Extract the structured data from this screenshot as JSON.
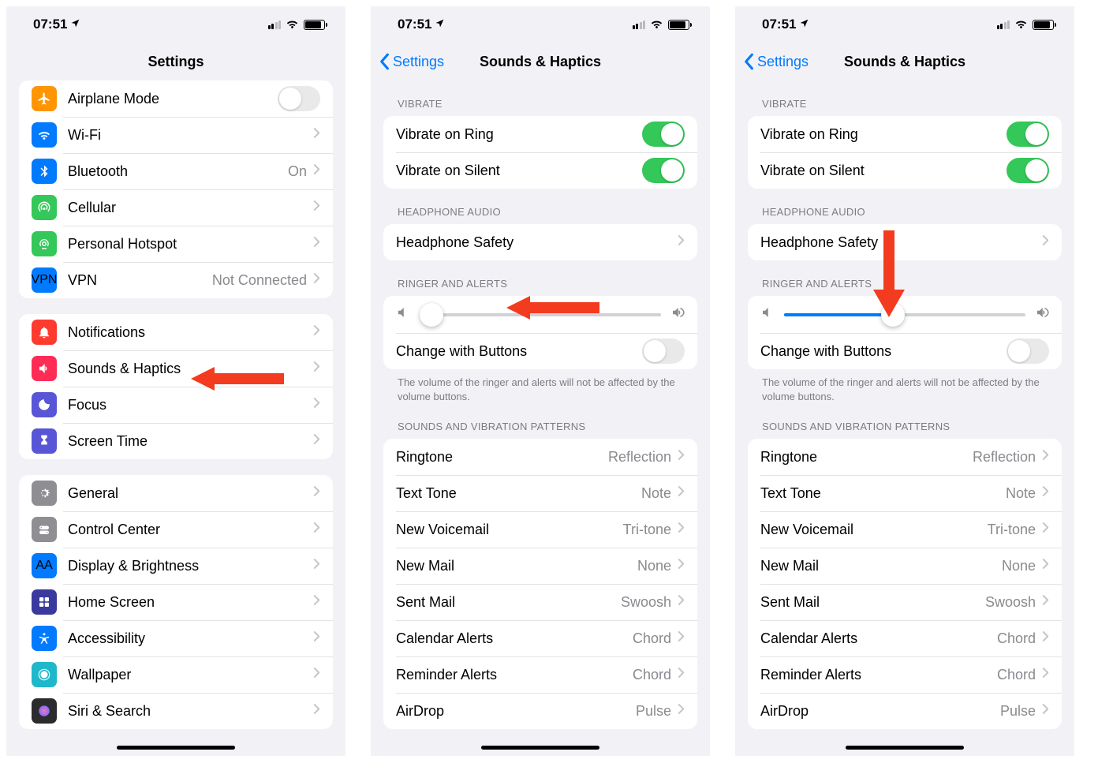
{
  "status": {
    "time": "07:51"
  },
  "screen1": {
    "title": "Settings",
    "group1": [
      {
        "label": "Airplane Mode",
        "icon": "airplane",
        "color": "#ff9500",
        "toggle": false
      },
      {
        "label": "Wi-Fi",
        "icon": "wifi",
        "color": "#007aff",
        "chevron": true
      },
      {
        "label": "Bluetooth",
        "icon": "bluetooth",
        "color": "#007aff",
        "value": "On",
        "chevron": true
      },
      {
        "label": "Cellular",
        "icon": "cellular",
        "color": "#34c759",
        "chevron": true
      },
      {
        "label": "Personal Hotspot",
        "icon": "hotspot",
        "color": "#34c759",
        "chevron": true
      },
      {
        "label": "VPN",
        "icon": "vpn",
        "color": "#007aff",
        "value": "Not Connected",
        "chevron": true
      }
    ],
    "group2": [
      {
        "label": "Notifications",
        "icon": "bell",
        "color": "#ff3b30",
        "chevron": true
      },
      {
        "label": "Sounds & Haptics",
        "icon": "speaker",
        "color": "#ff2d55",
        "chevron": true
      },
      {
        "label": "Focus",
        "icon": "moon",
        "color": "#5856d6",
        "chevron": true
      },
      {
        "label": "Screen Time",
        "icon": "hourglass",
        "color": "#5856d6",
        "chevron": true
      }
    ],
    "group3": [
      {
        "label": "General",
        "icon": "gear",
        "color": "#8e8e93",
        "chevron": true
      },
      {
        "label": "Control Center",
        "icon": "switches",
        "color": "#8e8e93",
        "chevron": true
      },
      {
        "label": "Display & Brightness",
        "icon": "aa",
        "color": "#007aff",
        "chevron": true
      },
      {
        "label": "Home Screen",
        "icon": "grid",
        "color": "#3a3a9e",
        "chevron": true
      },
      {
        "label": "Accessibility",
        "icon": "accessibility",
        "color": "#007aff",
        "chevron": true
      },
      {
        "label": "Wallpaper",
        "icon": "wallpaper",
        "color": "#1fb8ca",
        "chevron": true
      },
      {
        "label": "Siri & Search",
        "icon": "siri",
        "color": "#2c2c2e",
        "chevron": true
      }
    ]
  },
  "screen2": {
    "back": "Settings",
    "title": "Sounds & Haptics",
    "sections": {
      "vibrate": {
        "header": "VIBRATE",
        "rows": [
          {
            "label": "Vibrate on Ring",
            "toggle": true
          },
          {
            "label": "Vibrate on Silent",
            "toggle": true
          }
        ]
      },
      "headphone": {
        "header": "HEADPHONE AUDIO",
        "rows": [
          {
            "label": "Headphone Safety",
            "chevron": true
          }
        ]
      },
      "ringer_header": "RINGER AND ALERTS",
      "slider_value_low": 5,
      "slider_value_mid": 45,
      "change_with_buttons": {
        "label": "Change with Buttons",
        "toggle": false
      },
      "footer": "The volume of the ringer and alerts will not be affected by the volume buttons.",
      "patterns_header": "SOUNDS AND VIBRATION PATTERNS",
      "patterns": [
        {
          "label": "Ringtone",
          "value": "Reflection"
        },
        {
          "label": "Text Tone",
          "value": "Note"
        },
        {
          "label": "New Voicemail",
          "value": "Tri-tone"
        },
        {
          "label": "New Mail",
          "value": "None"
        },
        {
          "label": "Sent Mail",
          "value": "Swoosh"
        },
        {
          "label": "Calendar Alerts",
          "value": "Chord"
        },
        {
          "label": "Reminder Alerts",
          "value": "Chord"
        },
        {
          "label": "AirDrop",
          "value": "Pulse"
        }
      ]
    }
  },
  "arrow_color": "#f33b1f"
}
